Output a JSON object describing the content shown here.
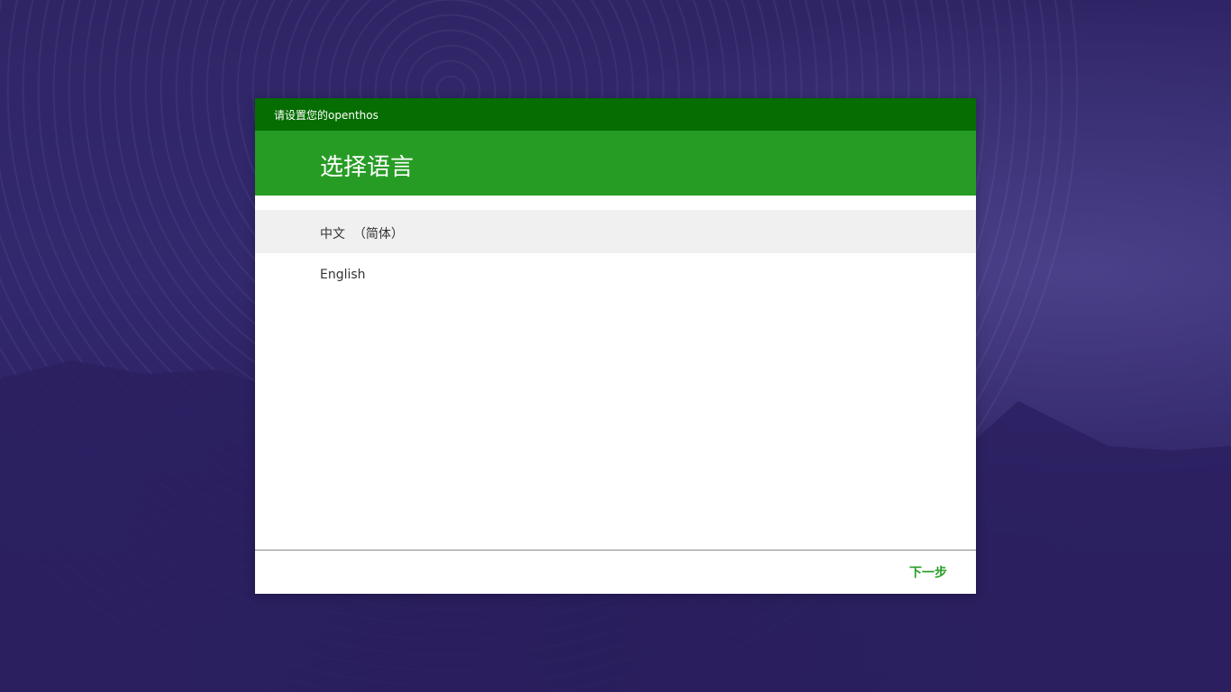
{
  "window": {
    "title": "请设置您的openthos"
  },
  "header": {
    "title": "选择语言"
  },
  "languages": [
    {
      "label": "中文  （简体）",
      "selected": true
    },
    {
      "label": "English",
      "selected": false
    }
  ],
  "footer": {
    "next_label": "下一步"
  },
  "colors": {
    "title_bar": "#056d01",
    "header": "#279c25",
    "accent": "#279c25",
    "selected_row": "#f0f0f0"
  }
}
